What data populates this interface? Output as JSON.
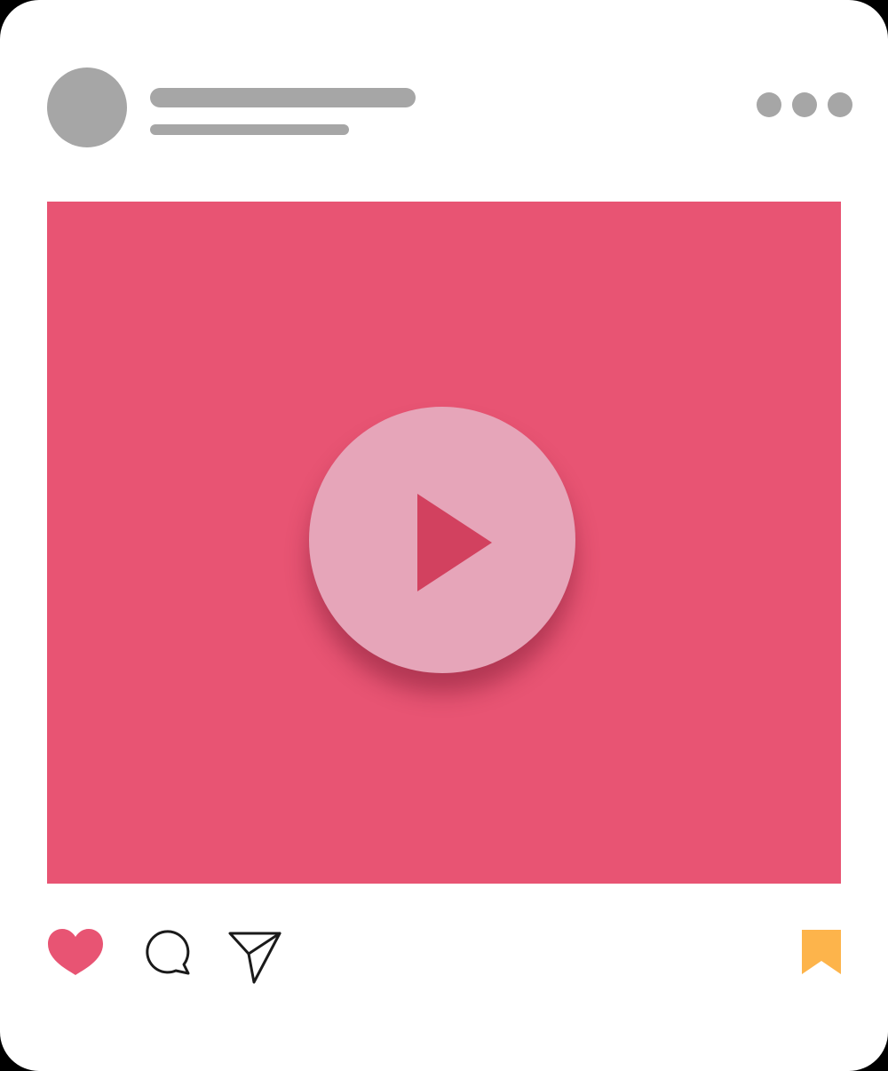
{
  "post": {
    "author": {
      "avatar_icon": "avatar-placeholder",
      "name_text": "",
      "subtitle_text": ""
    },
    "menu_icon": "more-horizontal-icon",
    "media": {
      "type": "video",
      "background_color": "#e85473",
      "play_button_color": "#e6a5b9",
      "play_icon_color": "#d2415f",
      "play_icon": "play-icon"
    },
    "actions": {
      "like": {
        "icon": "heart-icon",
        "color": "#e85473",
        "liked": true
      },
      "comment": {
        "icon": "comment-icon"
      },
      "share": {
        "icon": "send-icon"
      },
      "save": {
        "icon": "bookmark-icon",
        "color": "#fdb44b",
        "saved": true
      }
    }
  }
}
